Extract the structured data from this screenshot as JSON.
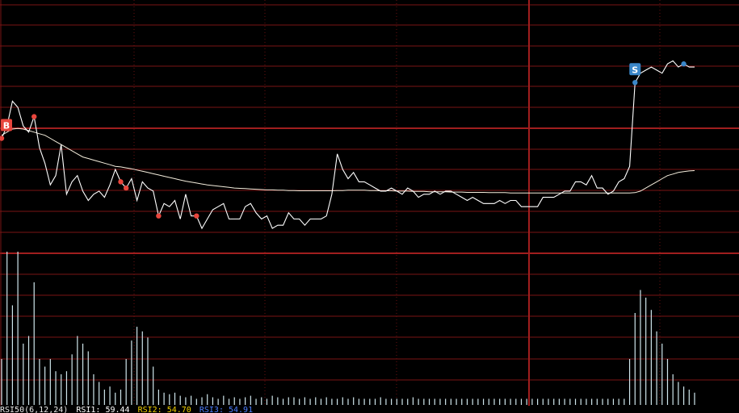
{
  "chart_data": {
    "type": "line",
    "title": "",
    "price_line_color": "#ffffff",
    "ma_line_color": "#f4eddc",
    "grid_color": "#7a1414",
    "strong_grid_color": "#a01e1e",
    "volume_color": "#cfe6ec",
    "marker_buy_color": "#e8453c",
    "marker_sell_color": "#3a86c8",
    "price": [
      66,
      70,
      78,
      76,
      70,
      68,
      73,
      63,
      58,
      51,
      54,
      64,
      48,
      52,
      54,
      49,
      46,
      48,
      49,
      47,
      51,
      56,
      52,
      50,
      53,
      46,
      52,
      50,
      49,
      41,
      45,
      44,
      46,
      40,
      48,
      41,
      41,
      37,
      40,
      43,
      44,
      45,
      40,
      40,
      40,
      44,
      45,
      42,
      40,
      41,
      37,
      38,
      38,
      42,
      40,
      40,
      38,
      40,
      40,
      40,
      41,
      48,
      61,
      56,
      53,
      55,
      52,
      52,
      51,
      50,
      49,
      49,
      50,
      49,
      48,
      50,
      49,
      47,
      48,
      48,
      49,
      48,
      49,
      49,
      48,
      47,
      46,
      47,
      46,
      45,
      45,
      45,
      46,
      45,
      46,
      46,
      44,
      44,
      44,
      44,
      47,
      47,
      47,
      48,
      49,
      49,
      52,
      52,
      51,
      54,
      50,
      50,
      48,
      49,
      52,
      53,
      57,
      84,
      87,
      88,
      89,
      88,
      87,
      90,
      91,
      89,
      90,
      89,
      89
    ],
    "ma": [
      67,
      68,
      69,
      69.2,
      69,
      68.5,
      68,
      67.5,
      67,
      66,
      65,
      64,
      63,
      62,
      61,
      60,
      59.5,
      59,
      58.5,
      58,
      57.5,
      57,
      56.8,
      56.5,
      56.2,
      55.8,
      55.4,
      55,
      54.6,
      54.2,
      53.8,
      53.4,
      53,
      52.6,
      52.2,
      51.9,
      51.6,
      51.3,
      51,
      50.8,
      50.6,
      50.4,
      50.2,
      50,
      49.9,
      49.8,
      49.7,
      49.6,
      49.5,
      49.4,
      49.4,
      49.3,
      49.3,
      49.2,
      49.2,
      49.1,
      49.1,
      49.1,
      49.1,
      49.1,
      49.1,
      49.1,
      49.2,
      49.2,
      49.3,
      49.3,
      49.3,
      49.3,
      49.2,
      49.2,
      49.1,
      49.1,
      49.1,
      49,
      49,
      49,
      48.9,
      48.9,
      48.9,
      48.8,
      48.8,
      48.8,
      48.8,
      48.7,
      48.7,
      48.7,
      48.6,
      48.6,
      48.6,
      48.6,
      48.5,
      48.5,
      48.5,
      48.5,
      48.4,
      48.4,
      48.4,
      48.4,
      48.4,
      48.4,
      48.4,
      48.4,
      48.4,
      48.4,
      48.4,
      48.4,
      48.4,
      48.4,
      48.4,
      48.4,
      48.4,
      48.4,
      48.4,
      48.4,
      48.4,
      48.4,
      48.4,
      48.5,
      49,
      50,
      51,
      52,
      53,
      54,
      54.5,
      55,
      55.3,
      55.5,
      55.6
    ],
    "volume": [
      30,
      100,
      65,
      100,
      40,
      45,
      80,
      30,
      25,
      30,
      22,
      20,
      22,
      33,
      45,
      40,
      35,
      20,
      15,
      10,
      12,
      8,
      10,
      30,
      42,
      51,
      48,
      44,
      25,
      10,
      8,
      7,
      8,
      6,
      5,
      6,
      4,
      5,
      7,
      5,
      4,
      6,
      4,
      5,
      4,
      5,
      6,
      4,
      5,
      4,
      6,
      5,
      4,
      5,
      5,
      4,
      5,
      4,
      5,
      4,
      5,
      4,
      4,
      5,
      4,
      5,
      4,
      4,
      4,
      4,
      5,
      4,
      4,
      4,
      4,
      4,
      5,
      4,
      4,
      4,
      4,
      4,
      4,
      4,
      4,
      4,
      4,
      4,
      4,
      4,
      4,
      4,
      4,
      4,
      4,
      4,
      4,
      4,
      4,
      4,
      4,
      4,
      4,
      4,
      4,
      4,
      4,
      4,
      4,
      4,
      4,
      4,
      4,
      4,
      4,
      4,
      30,
      60,
      75,
      70,
      62,
      48,
      40,
      30,
      20,
      15,
      12,
      10,
      8
    ],
    "markers": [
      {
        "type": "buy",
        "label": "B",
        "index": 0
      },
      {
        "type": "sell",
        "label": "S",
        "index": 117
      }
    ],
    "dots": [
      {
        "color": "buy",
        "index": 0
      },
      {
        "color": "buy",
        "index": 6
      },
      {
        "color": "buy",
        "index": 22
      },
      {
        "color": "buy",
        "index": 23
      },
      {
        "color": "buy",
        "index": 29
      },
      {
        "color": "buy",
        "index": 36
      },
      {
        "color": "sell",
        "index": 117
      },
      {
        "color": "sell",
        "index": 126
      }
    ]
  },
  "rsi_legend": [
    {
      "text": "RSI50(6,12,24)",
      "color": "#e8e8e8"
    },
    {
      "text": "RSI1: 59.44",
      "color": "#ffffff"
    },
    {
      "text": "RSI2: 54.70",
      "color": "#f0d000"
    },
    {
      "text": "RSI3: 54.91",
      "color": "#4a7dff"
    }
  ]
}
